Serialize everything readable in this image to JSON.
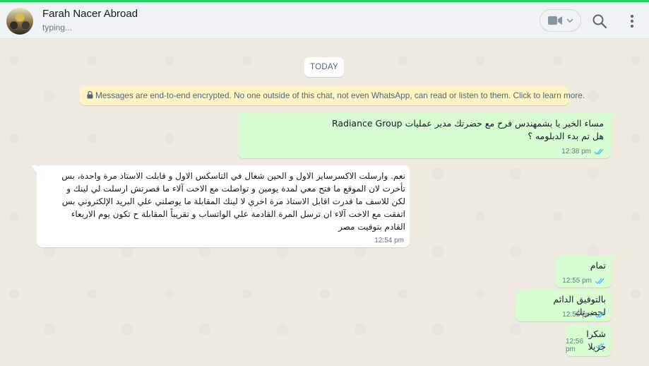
{
  "header": {
    "contact_name": "Farah Nacer Abroad",
    "status": "typing...",
    "icons": [
      "avatar",
      "video-call-icon",
      "chevron-down-icon",
      "search-icon",
      "menu-icon"
    ]
  },
  "chat": {
    "date_label": "TODAY",
    "encryption_notice": "Messages are end-to-end encrypted. No one outside of this chat, not even WhatsApp, can read or listen to them. Click to learn more.",
    "messages": [
      {
        "direction": "outgoing",
        "text": "مساء الخير يا بشمهندس فرح مع حضرتك  مدير عمليات Radiance Group\nهل تم بدء الدبلومه ؟",
        "time": "12:38 pm",
        "status": "read"
      },
      {
        "direction": "incoming",
        "text": "نعم. وارسلت الاكسرسايز الاول و الحين شغال في التاسكس الاول و قابلت الاستاذ مرة واحدة، بس\nتأخرت لان الموقع ما فتح معي لمدة يومين و تواصلت مع الاخت آلاء ما قصرتش ارسلت لي لينك و\nلكن للاسف ما قدرت اقابل الاستاذ مرة اخري لا لينك المقابلة ما يوصلني علي البريد الإلكتروني بس\nاتفقت مع الاخت آلاء ان ترسل المرة القادمة علي الواتساب و تقريباً المقابلة ح تكون يوم الاربعاء\nالقادم بتوقيت مصر",
        "time": "12:54 pm"
      },
      {
        "direction": "outgoing",
        "text": "تمام",
        "time": "12:55 pm",
        "status": "read"
      },
      {
        "direction": "outgoing",
        "text": "بالتوفيق الدائم لحضرتك",
        "time": "12:55 pm",
        "status": "read"
      },
      {
        "direction": "outgoing",
        "text": "شكرا جزيلا",
        "time": "12:56 pm",
        "status": "read"
      }
    ]
  },
  "colors": {
    "outgoing_bubble": "#d9fdd3",
    "incoming_bubble": "#ffffff",
    "read_ticks": "#53bdeb",
    "chat_background": "#efeae2",
    "encryption_notice_bg": "#fff5c4"
  }
}
